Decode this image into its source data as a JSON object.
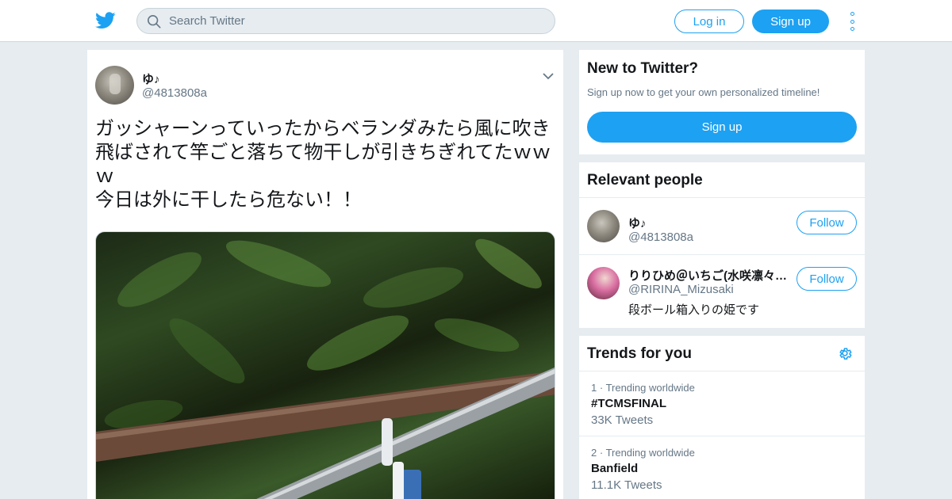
{
  "header": {
    "search_placeholder": "Search Twitter",
    "login_label": "Log in",
    "signup_label": "Sign up",
    "brand_color": "#1da1f2"
  },
  "tweet": {
    "author_name": "ゆ♪",
    "author_handle": "@4813808a",
    "text_lines": [
      "ガッシャーンっていったからベランダみたら風に吹き",
      "飛ばされて竿ごと落ちて物干しが引きちぎれてたｗｗ",
      "ｗ",
      "今日は外に干したら危ない！！"
    ],
    "icons": [
      "twitter-logo-icon",
      "search-icon",
      "chevron-down-icon",
      "more-vertical-icon"
    ]
  },
  "new_to_twitter": {
    "title": "New to Twitter?",
    "subtitle": "Sign up now to get your own personalized timeline!",
    "button_label": "Sign up"
  },
  "relevant_people": {
    "title": "Relevant people",
    "people": [
      {
        "name": "ゆ♪",
        "handle": "@4813808a",
        "bio": "",
        "follow_label": "Follow"
      },
      {
        "name": "りりひめ＠いちご(水咲凛々…",
        "handle": "@RIRINA_Mizusaki",
        "bio": "段ボール箱入りの姫です",
        "follow_label": "Follow"
      }
    ]
  },
  "trends": {
    "title": "Trends for you",
    "items": [
      {
        "rank": "1",
        "meta": "Trending worldwide",
        "name": "#TCMSFINAL",
        "count": "33K Tweets"
      },
      {
        "rank": "2",
        "meta": "Trending worldwide",
        "name": "Banfield",
        "count": "11.1K Tweets"
      }
    ]
  }
}
